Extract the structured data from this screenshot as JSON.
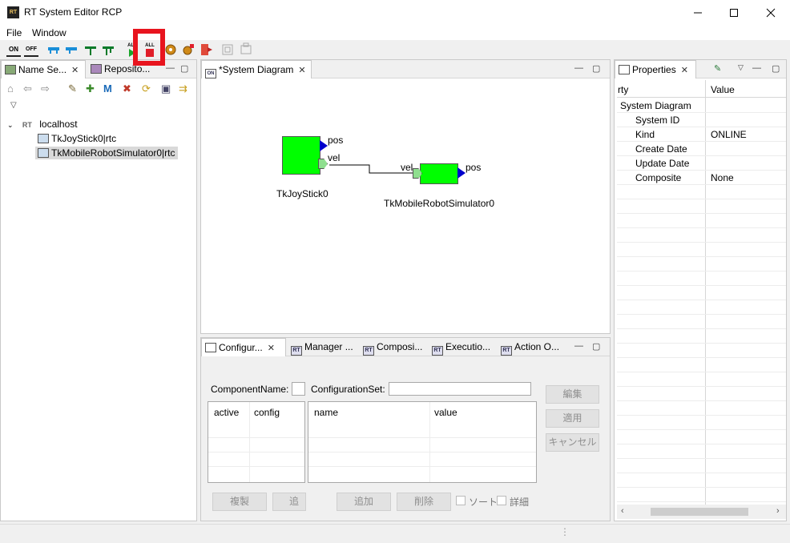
{
  "window": {
    "title": "RT System Editor RCP",
    "app_icon_text": "RT"
  },
  "menu": {
    "file": "File",
    "window": "Window"
  },
  "toolbar": {
    "on_label": "ON",
    "off_label": "OFF",
    "all_start_label": "ALL",
    "all_stop_label": "ALL"
  },
  "name_service": {
    "tab_label": "Name Se...",
    "repo_tab_label": "Reposito...",
    "tree": {
      "host": "localhost",
      "host_prefix": "RT",
      "items": [
        "TkJoyStick0|rtc",
        "TkMobileRobotSimulator0|rtc"
      ]
    }
  },
  "diagram": {
    "tab_label": "*System Diagram",
    "tab_icon_text": "ON",
    "components": [
      {
        "name": "TkJoyStick0",
        "ports": {
          "out1": "pos",
          "out2": "vel"
        }
      },
      {
        "name": "TkMobileRobotSimulator0",
        "ports": {
          "in1": "vel",
          "out1": "pos"
        }
      }
    ]
  },
  "properties": {
    "tab_label": "Properties",
    "col_property": "rty",
    "col_value": "Value",
    "group": "System Diagram",
    "rows": [
      {
        "name": "System ID",
        "value": ""
      },
      {
        "name": "Kind",
        "value": "ONLINE"
      },
      {
        "name": "Create Date",
        "value": ""
      },
      {
        "name": "Update Date",
        "value": ""
      },
      {
        "name": "Composite",
        "value": "None"
      }
    ]
  },
  "config": {
    "tabs": [
      "Configur...",
      "Manager ...",
      "Composi...",
      "Executio...",
      "Action O..."
    ],
    "component_name_label": "ComponentName:",
    "component_name_value": "",
    "configuration_set_label": "ConfigurationSet:",
    "configuration_set_value": "",
    "left_headers": [
      "active",
      "config"
    ],
    "right_headers": [
      "name",
      "value"
    ],
    "edit_button": "編集",
    "apply_button": "適用",
    "cancel_button": "キャンセル",
    "copy_button": "複製",
    "add_left_button": "追加",
    "add_button": "追加",
    "delete_button": "削除",
    "sort_label": "ソート",
    "detail_label": "詳細"
  },
  "colors": {
    "component_fill": "#00ff00",
    "port_out": "#0000cc",
    "highlight_box": "#e8141e"
  }
}
